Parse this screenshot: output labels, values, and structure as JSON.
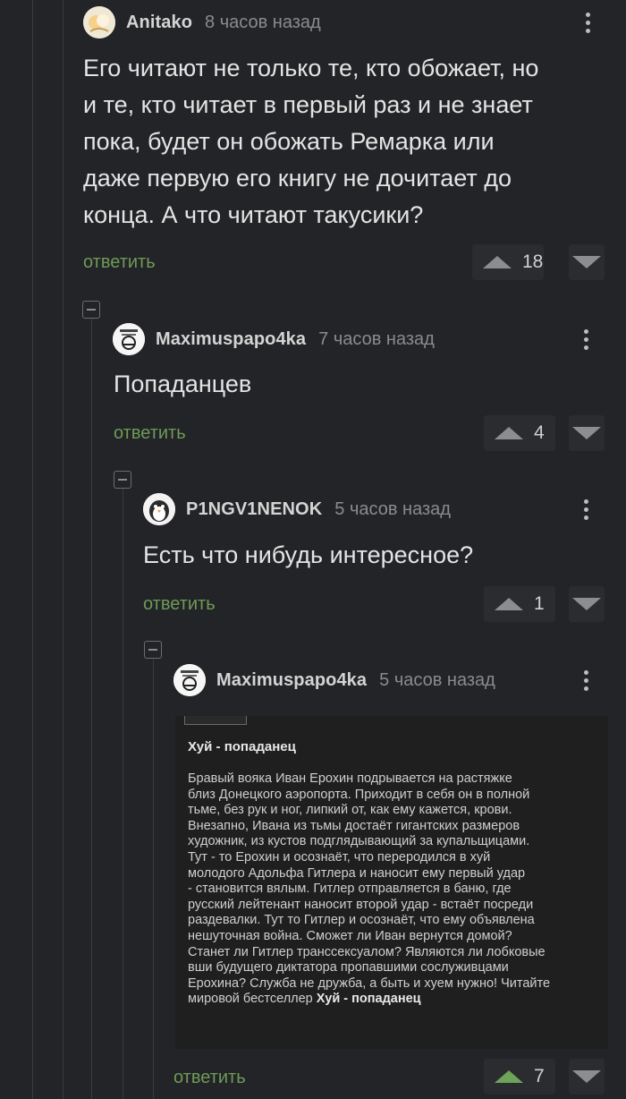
{
  "comments": [
    {
      "username": "Anitako",
      "timestamp": "8 часов назад",
      "text_lines": [
        "Его читают не только те, кто обожает, но",
        "и те, кто читает в первый раз и не знает",
        "пока, будет он обожать Ремарка или",
        "даже первую его книгу не дочитает до",
        "конца. А что читают такусики?"
      ],
      "reply_label": "ответить",
      "score": "18"
    },
    {
      "username": "Maximuspapo4ka",
      "timestamp": "7 часов назад",
      "text": "Попаданцев",
      "reply_label": "ответить",
      "score": "4"
    },
    {
      "username": "P1NGV1NENOK",
      "timestamp": "5 часов назад",
      "text": "Есть что нибудь интересное?",
      "reply_label": "ответить",
      "score": "1"
    },
    {
      "username": "Maximuspapo4ka",
      "timestamp": "5 часов назад",
      "reply_label": "ответить",
      "score": "7",
      "image": {
        "title": "Хуй - попаданец",
        "lines": [
          "Бравый вояка Иван Ерохин подрывается на растяжке",
          "близ Донецкого аэропорта. Приходит в себя он в полной",
          "тьме, без рук и ног, липкий от, как ему кажется, крови.",
          "Внезапно, Ивана из тьмы достаёт гигантских размеров",
          "художник, из кустов подглядывающий за купальщицами.",
          "Тут - то Ерохин и осознаёт, что переродился в хуй",
          "молодого Адольфа Гитлера и наносит ему первый удар",
          "- становится вялым. Гитлер отправляется в баню, где",
          "русский лейтенант наносит второй удар - встаёт посреди",
          "раздевалки. Тут то Гитлер и осознаёт, что ему объявлена",
          "нешуточная война. Сможет ли Иван вернутся домой?",
          "Станет ли Гитлер транссексуалом? Являются ли лобковые",
          "вши будущего диктатора пропавшими сослуживцами",
          "Ерохина? Служба не дружба, а быть и хуем нужно! Читайте"
        ],
        "last_line_prefix": "мировой бестселлер ",
        "last_line_bold": "Хуй - попаданец"
      }
    }
  ],
  "colors": {
    "background": "#232427",
    "reply": "#6e9a58",
    "upvote_active": "#6ea35a"
  }
}
